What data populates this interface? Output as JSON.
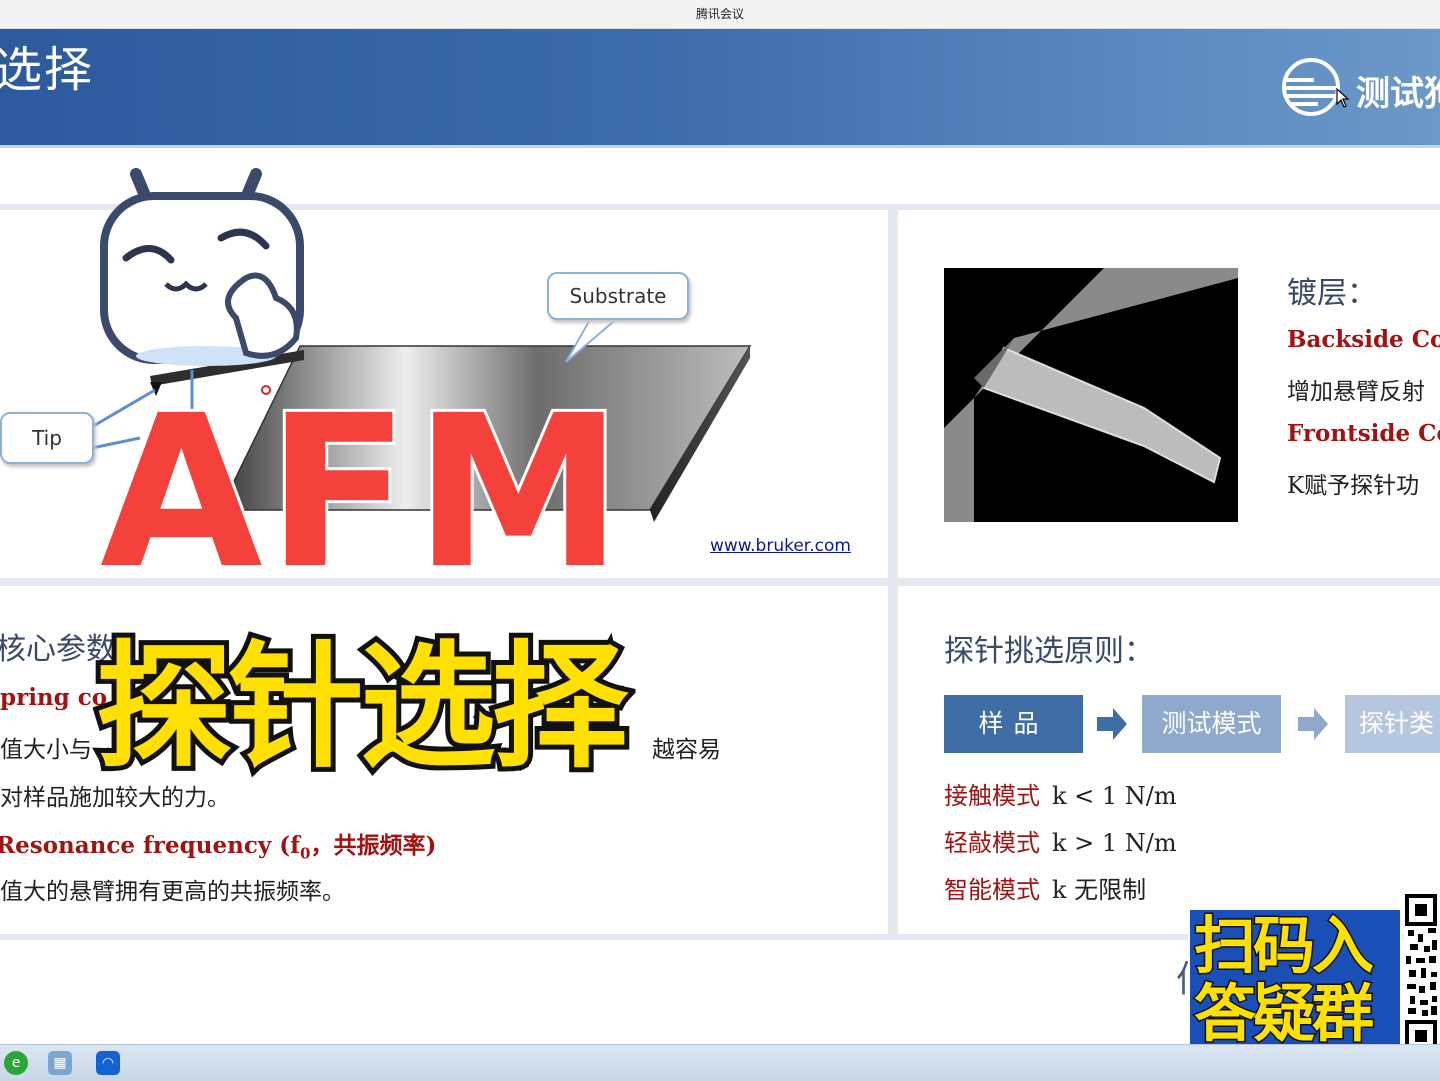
{
  "window": {
    "title": "腾讯会议"
  },
  "slide": {
    "header_title": "选择",
    "logo_text": "测试狗",
    "diagram": {
      "substrate_label": "Substrate",
      "tip_label": "Tip",
      "source_link": "www.bruker.com"
    },
    "overlay": {
      "afm": "AFM",
      "title_cn": "探针选择"
    },
    "coating": {
      "title": "镀层：",
      "backside_label": "Backside Coa",
      "backside_desc": "增加悬臂反射",
      "frontside_label": "Frontside Coa",
      "frontside_desc": "K赋予探针功"
    },
    "params": {
      "title": "核心参数",
      "spring_label": "pring co",
      "spring_desc_a": "值大小与",
      "spring_desc_b": "越容易",
      "spring_desc_c": "对样品施加较大的力。",
      "resonance_label": "Resonance frequency (f",
      "resonance_sub": "0",
      "resonance_label_end": "，共振频率)",
      "resonance_desc": "值大的悬臂拥有更高的共振频率。"
    },
    "principle": {
      "title": "探针挑选原则：",
      "steps": [
        "样品",
        "测试模式",
        "探针类"
      ],
      "modes": [
        {
          "name": "接触模式",
          "value": "k < 1 N/m"
        },
        {
          "name": "轻敲模式",
          "value": "k > 1 N/m"
        },
        {
          "name": "智能模式",
          "value": "k 无限制"
        }
      ]
    },
    "promo": {
      "line1": "扫码入",
      "line2": "答疑群"
    },
    "partial_char": "佰"
  },
  "taskbar": {
    "icons": [
      "ie-icon",
      "control-panel-icon",
      "tencent-meeting-icon"
    ]
  },
  "colors": {
    "header": "#3c6ba9",
    "red_label": "#a11313",
    "step_primary": "#3f6ea7",
    "afm_red": "#f4413b",
    "overlay_yellow": "#ffe000"
  }
}
